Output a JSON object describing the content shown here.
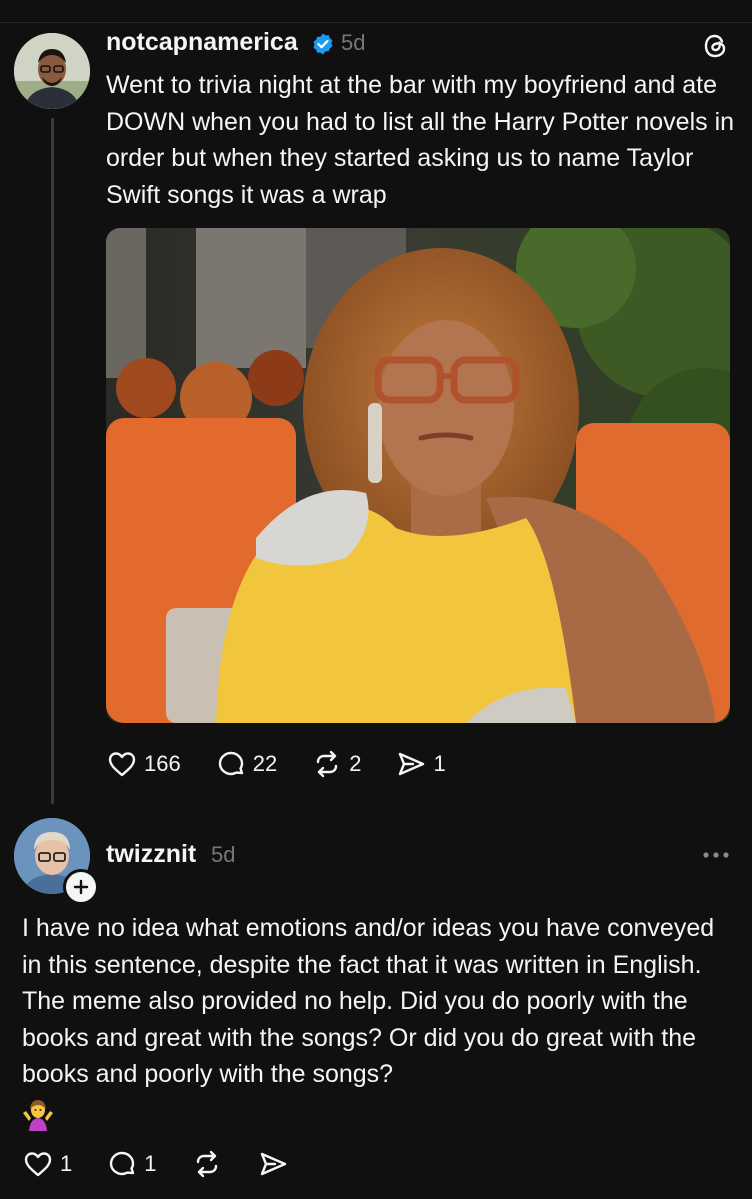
{
  "post": {
    "username": "notcapnamerica",
    "time": "5d",
    "text": "Went to trivia night at the bar with my boyfriend and ate DOWN when you had to list all the Harry Potter novels in order but when they started asking us to name Taylor Swift songs it was a wrap",
    "stats": {
      "likes": "166",
      "comments": "22",
      "reposts": "2",
      "shares": "1"
    }
  },
  "reply": {
    "username": "twizznit",
    "time": "5d",
    "text": "I have no idea what emotions and/or ideas you have conveyed in this sentence, despite the fact that it was written in English. The meme also provided no help. Did you do poorly with the books and great with the songs? Or did you do great with the books and poorly with the songs?",
    "emoji_icon": "woman-shrugging-emoji",
    "stats": {
      "likes": "1",
      "comments": "1"
    }
  },
  "colors": {
    "background": "#101010",
    "text": "#f3f5f7",
    "muted": "#777777",
    "verified": "#1d9bf0"
  }
}
